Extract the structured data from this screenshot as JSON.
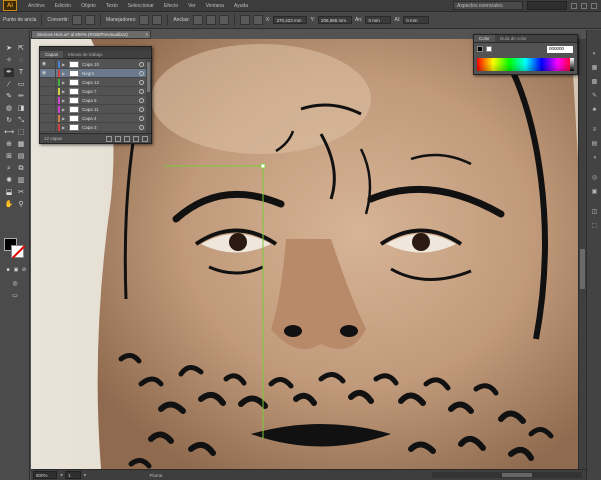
{
  "app": {
    "logo": "Ai",
    "menu": [
      "Archivo",
      "Edición",
      "Objeto",
      "Texto",
      "Seleccionar",
      "Efecto",
      "Ver",
      "Ventana",
      "Ayuda"
    ],
    "workspace": "Aspectos esenciales"
  },
  "controlbar": {
    "mode_label": "Punto de ancla",
    "convert_label": "Convertir:",
    "handles_label": "Manejadores:",
    "anchors_label": "Anclas:",
    "x_label": "X:",
    "x_value": "370,423 mm",
    "y_label": "Y:",
    "y_value": "206,985 mm",
    "w_label": "An:",
    "w_value": "0 mm",
    "h_label": "Al:",
    "h_value": "0 mm"
  },
  "document_tab": {
    "title": "Sinticos Hick.ai* al 800% (RGB/Previsualizar)",
    "close": "×"
  },
  "statusbar": {
    "zoom": "800%",
    "artboard": "1",
    "tool": "Pluma"
  },
  "layers_panel": {
    "tabs": [
      "Capas",
      "Mesas de trabajo"
    ],
    "active_tab": "Capas",
    "rows": [
      {
        "name": "Capa 10",
        "color": "#4f7fd0",
        "selected": false,
        "visible": true
      },
      {
        "name": "Negro",
        "color": "#d04040",
        "selected": true,
        "visible": true
      },
      {
        "name": "Capa 12",
        "color": "#40b040",
        "selected": false,
        "visible": false
      },
      {
        "name": "Capa 7",
        "color": "#d0d040",
        "selected": false,
        "visible": false
      },
      {
        "name": "Capa 5",
        "color": "#d040d0",
        "selected": false,
        "visible": false
      },
      {
        "name": "Capa 11",
        "color": "#d040d0",
        "selected": false,
        "visible": false
      },
      {
        "name": "Capa 4",
        "color": "#d08040",
        "selected": false,
        "visible": false
      },
      {
        "name": "Capa 3",
        "color": "#d04040",
        "selected": false,
        "visible": false
      }
    ],
    "footer": "12 capas"
  },
  "color_panel": {
    "tabs": [
      "Color",
      "Guía de color"
    ],
    "active_tab": "Color",
    "hex": "000000",
    "fill_color": "#000000",
    "stroke_color": "#ffffff"
  },
  "colors": {
    "skin": "#c9a688",
    "ink": "#111111",
    "guide": "#7acc3a"
  }
}
